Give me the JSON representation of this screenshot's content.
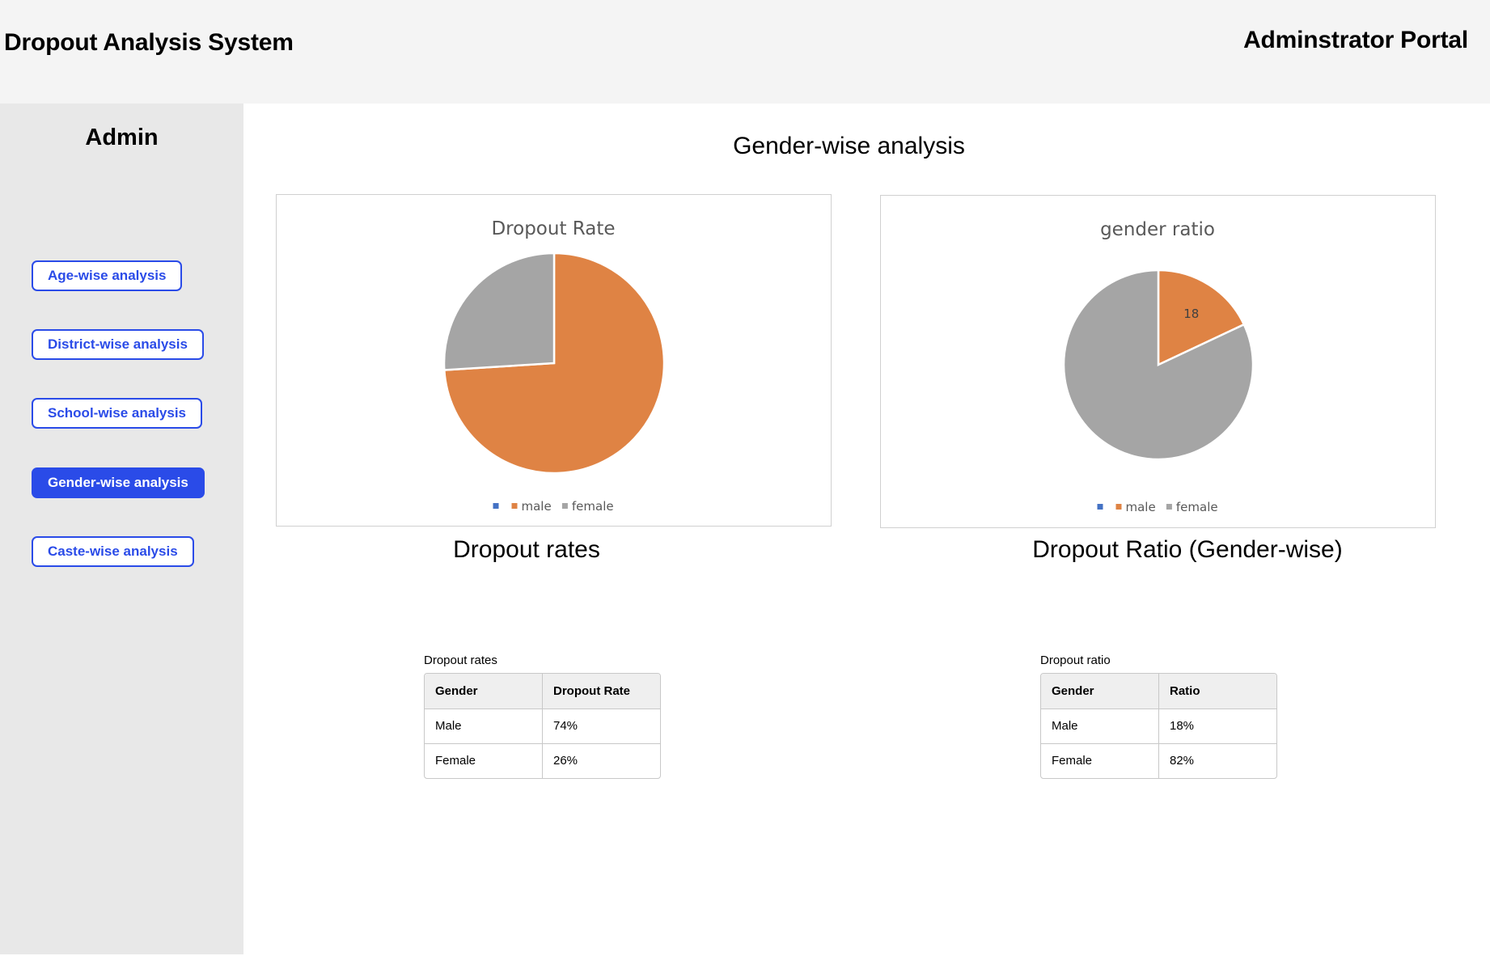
{
  "header": {
    "app_title": "Dropout Analysis System",
    "portal_title": "Adminstrator Portal"
  },
  "sidebar": {
    "title": "Admin",
    "items": [
      {
        "label": "Age-wise analysis",
        "active": false
      },
      {
        "label": "District-wise analysis",
        "active": false
      },
      {
        "label": "School-wise analysis",
        "active": false
      },
      {
        "label": "Gender-wise analysis",
        "active": true
      },
      {
        "label": "Caste-wise analysis",
        "active": false
      }
    ]
  },
  "main": {
    "title": "Gender-wise analysis",
    "left_caption": "Dropout rates",
    "right_caption": "Dropout Ratio (Gender-wise)"
  },
  "colors": {
    "accent": "#2a4be8",
    "male": "#df8344",
    "female": "#a5a5a5",
    "blank_series": "#4472c4"
  },
  "chart_data": [
    {
      "type": "pie",
      "title": "Dropout Rate",
      "categories": [
        "",
        "male",
        "female"
      ],
      "values": [
        0,
        74,
        26
      ],
      "data_labels": [
        "",
        "",
        ""
      ],
      "legend": "bottom",
      "legend_labels": [
        "",
        "male",
        "female"
      ]
    },
    {
      "type": "pie",
      "title": "gender ratio",
      "categories": [
        "",
        "male",
        "female"
      ],
      "values": [
        0,
        18,
        82
      ],
      "data_labels": [
        "",
        "18",
        ""
      ],
      "legend": "bottom",
      "legend_labels": [
        "",
        "male",
        "female"
      ]
    }
  ],
  "tables": {
    "rates": {
      "caption": "Dropout rates",
      "headers": [
        "Gender",
        "Dropout Rate"
      ],
      "rows": [
        [
          "Male",
          "74%"
        ],
        [
          "Female",
          "26%"
        ]
      ]
    },
    "ratio": {
      "caption": "Dropout ratio",
      "headers": [
        "Gender",
        "Ratio"
      ],
      "rows": [
        [
          "Male",
          "18%"
        ],
        [
          "Female",
          "82%"
        ]
      ]
    }
  }
}
